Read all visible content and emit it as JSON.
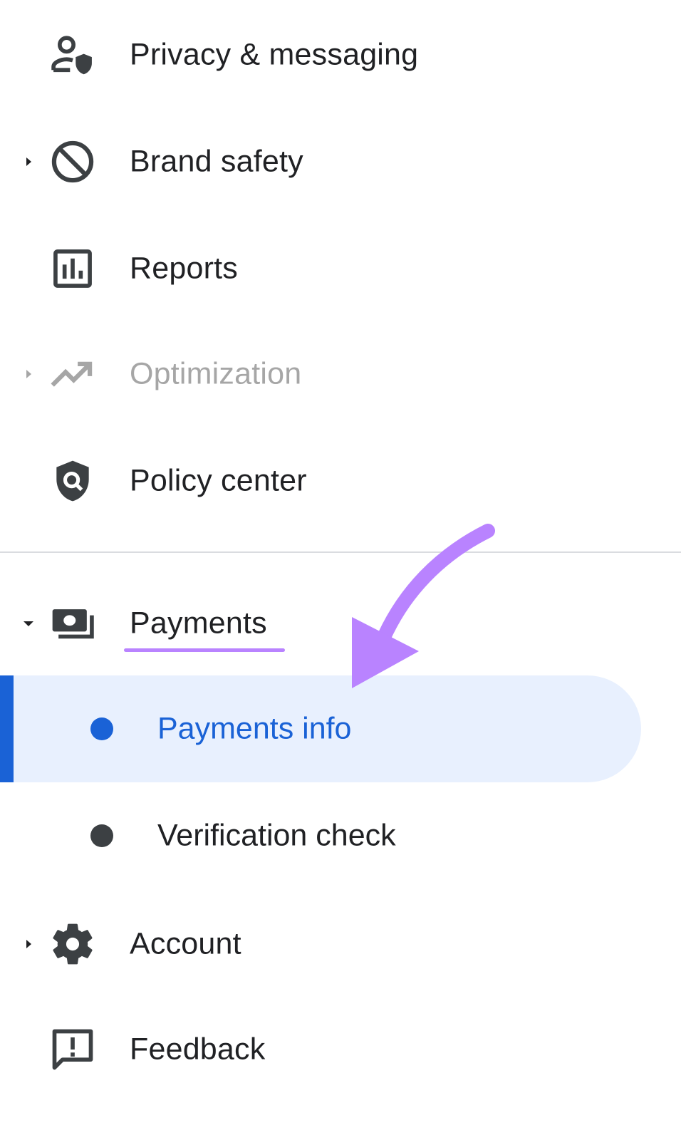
{
  "nav": {
    "items": [
      {
        "label": "Privacy & messaging",
        "icon": "privacy-shield-user-icon"
      },
      {
        "label": "Brand safety",
        "icon": "block-icon"
      },
      {
        "label": "Reports",
        "icon": "bar-chart-icon"
      },
      {
        "label": "Optimization",
        "icon": "trending-up-icon"
      },
      {
        "label": "Policy center",
        "icon": "policy-shield-icon"
      },
      {
        "label": "Payments",
        "icon": "payments-icon"
      },
      {
        "label": "Account",
        "icon": "gear-icon"
      },
      {
        "label": "Feedback",
        "icon": "feedback-icon"
      }
    ],
    "payments_sub": [
      {
        "label": "Payments info",
        "active": true
      },
      {
        "label": "Verification check",
        "active": false
      }
    ]
  },
  "colors": {
    "accent": "#1a62d6",
    "active_background": "#e8f0fe",
    "annotation": "#b983ff",
    "text": "#202124",
    "disabled_text": "#a6a6a6",
    "divider": "#dadce0"
  }
}
